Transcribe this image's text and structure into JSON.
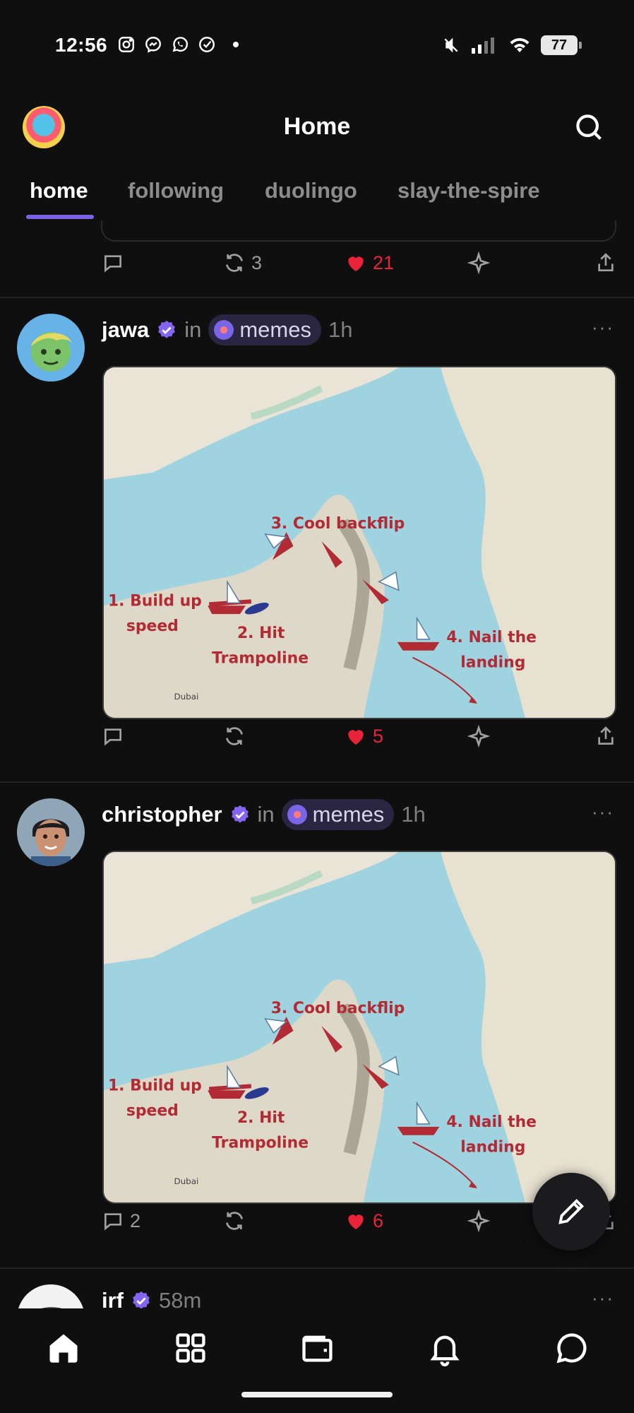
{
  "status_bar": {
    "time": "12:56",
    "battery": "77",
    "left_icons": [
      "instagram-icon",
      "messenger-icon",
      "whatsapp-icon",
      "check-circle-icon"
    ],
    "right_icons": [
      "mute-icon",
      "signal-icon",
      "wifi-icon",
      "battery-icon"
    ]
  },
  "header": {
    "title": "Home"
  },
  "tabs": [
    {
      "label": "home",
      "active": true
    },
    {
      "label": "following",
      "active": false
    },
    {
      "label": "duolingo",
      "active": false
    },
    {
      "label": "slay-the-spire",
      "active": false
    }
  ],
  "prev_post": {
    "recasts": "3",
    "likes": "21"
  },
  "posts": [
    {
      "username": "jawa",
      "in_label": "in",
      "community": "memes",
      "time": "1h",
      "more": "···",
      "image": {
        "step1a": "1. Build up",
        "step1b": "speed",
        "step2a": "2. Hit",
        "step2b": "Trampoline",
        "step3": "3. Cool backflip",
        "step4a": "4. Nail the",
        "step4b": "landing",
        "place": "Dubai"
      },
      "comments": "",
      "likes": "5"
    },
    {
      "username": "christopher",
      "in_label": "in",
      "community": "memes",
      "time": "1h",
      "more": "···",
      "image": {
        "step1a": "1. Build up",
        "step1b": "speed",
        "step2a": "2. Hit",
        "step2b": "Trampoline",
        "step3": "3. Cool backflip",
        "step4a": "4. Nail the",
        "step4b": "landing",
        "place": "Dubai"
      },
      "comments": "2",
      "likes": "6"
    },
    {
      "username": "irf",
      "time": "58m",
      "more": "···"
    }
  ],
  "colors": {
    "accent": "#7b63e6",
    "like": "#e9243a",
    "background": "#0f0f10"
  }
}
